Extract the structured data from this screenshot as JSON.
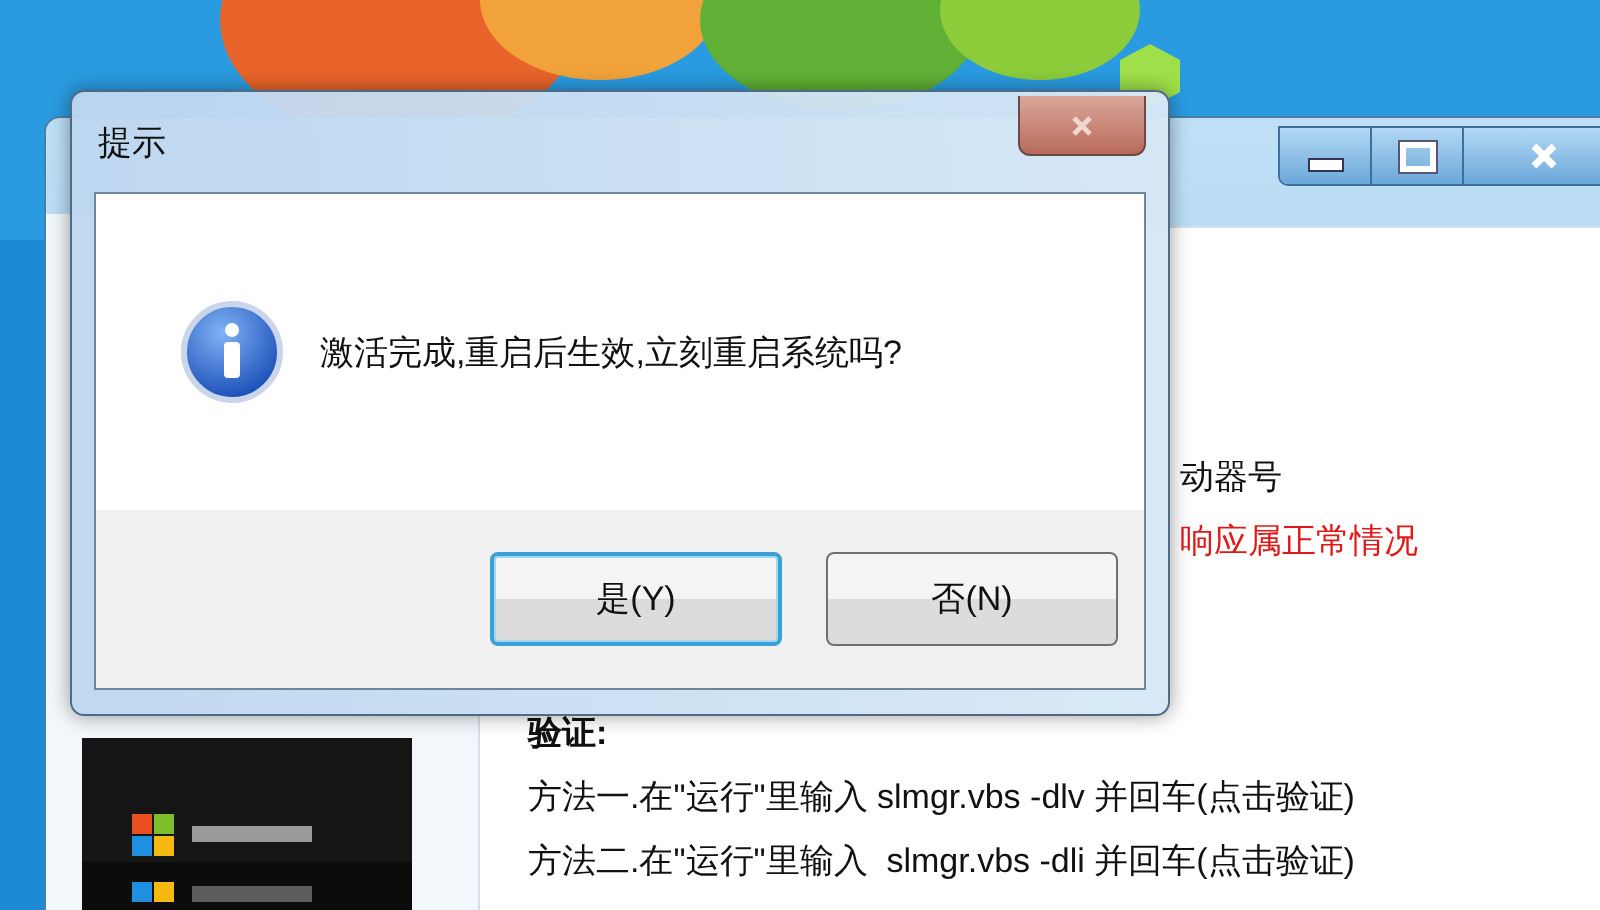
{
  "background_window": {
    "lines": [
      {
        "text": "动器号",
        "kind": "normal"
      },
      {
        "text": "响应属正常情况",
        "kind": "warning"
      },
      {
        "text": "验证:",
        "kind": "heading"
      },
      {
        "text": "方法一.在\"运行\"里输入 slmgr.vbs -dlv 并回车(点击验证)",
        "kind": "normal"
      },
      {
        "text": "方法二.在\"运行\"里输入  slmgr.vbs -dli 并回车(点击验证)",
        "kind": "normal"
      }
    ]
  },
  "dialog": {
    "title": "提示",
    "message": "激活完成,重启后生效,立刻重启系统吗?",
    "buttons": [
      {
        "label": "是(Y)",
        "focused": true
      },
      {
        "label": "否(N)",
        "focused": false
      }
    ]
  }
}
